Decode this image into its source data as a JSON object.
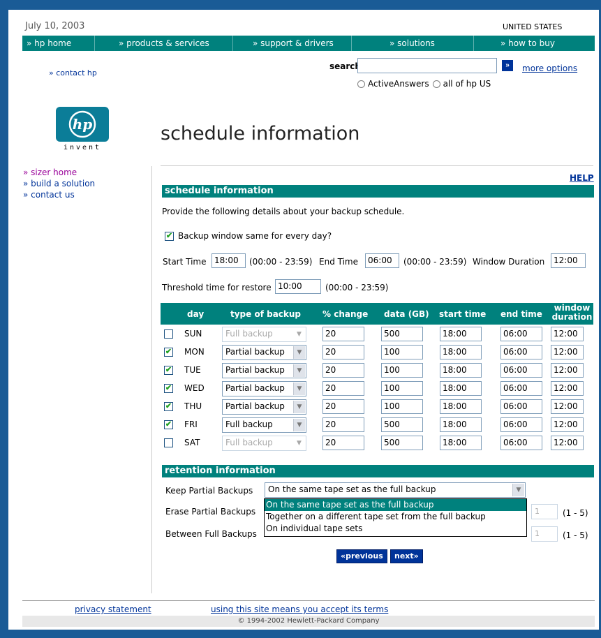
{
  "header": {
    "date": "July 10, 2003",
    "country": "UNITED STATES"
  },
  "topnav": [
    {
      "label": "» hp home"
    },
    {
      "label": "» products & services"
    },
    {
      "label": "» support & drivers"
    },
    {
      "label": "» solutions"
    },
    {
      "label": "» how to buy"
    }
  ],
  "contact_hp": "» contact hp",
  "search": {
    "label": "search:",
    "value": "",
    "go": "»",
    "more_options": "more options",
    "radio_1": "ActiveAnswers",
    "radio_2": "all of hp US"
  },
  "logo": {
    "mark": "hp",
    "tagline": "invent"
  },
  "page_title": "schedule information",
  "leftnav": [
    {
      "label": "» sizer home"
    },
    {
      "label": "» build a solution"
    },
    {
      "label": "» contact us"
    }
  ],
  "help": "HELP",
  "schedule": {
    "section_title": "schedule information",
    "intro": "Provide the following details about your backup schedule.",
    "same_window_label": "Backup window same for every day?",
    "same_window_checked": true,
    "start_time_label": "Start Time",
    "start_time": "18:00",
    "range_hint": "(00:00 - 23:59)",
    "end_time_label": "End Time",
    "end_time": "06:00",
    "window_duration_label": "Window Duration",
    "window_duration": "12:00",
    "threshold_label": "Threshold time for restore",
    "threshold": "10:00"
  },
  "table": {
    "headers": {
      "day": "day",
      "type": "type of backup",
      "change": "% change",
      "data": "data (GB)",
      "start": "start time",
      "end": "end time",
      "window_1": "window",
      "window_2": "duration"
    },
    "rows": [
      {
        "checked": false,
        "day": "SUN",
        "type": "Full backup",
        "enabled": false,
        "change": "20",
        "data": "500",
        "start": "18:00",
        "end": "06:00",
        "window": "12:00"
      },
      {
        "checked": true,
        "day": "MON",
        "type": "Partial backup",
        "enabled": true,
        "change": "20",
        "data": "100",
        "start": "18:00",
        "end": "06:00",
        "window": "12:00"
      },
      {
        "checked": true,
        "day": "TUE",
        "type": "Partial backup",
        "enabled": true,
        "change": "20",
        "data": "100",
        "start": "18:00",
        "end": "06:00",
        "window": "12:00"
      },
      {
        "checked": true,
        "day": "WED",
        "type": "Partial backup",
        "enabled": true,
        "change": "20",
        "data": "100",
        "start": "18:00",
        "end": "06:00",
        "window": "12:00"
      },
      {
        "checked": true,
        "day": "THU",
        "type": "Partial backup",
        "enabled": true,
        "change": "20",
        "data": "100",
        "start": "18:00",
        "end": "06:00",
        "window": "12:00"
      },
      {
        "checked": true,
        "day": "FRI",
        "type": "Full backup",
        "enabled": true,
        "change": "20",
        "data": "500",
        "start": "18:00",
        "end": "06:00",
        "window": "12:00"
      },
      {
        "checked": false,
        "day": "SAT",
        "type": "Full backup",
        "enabled": false,
        "change": "20",
        "data": "500",
        "start": "18:00",
        "end": "06:00",
        "window": "12:00"
      }
    ]
  },
  "retention": {
    "section_title": "retention information",
    "keep_label": "Keep Partial Backups",
    "keep_value": "On the same tape set as the full backup",
    "erase_label": "Erase Partial Backups",
    "between_label": "Between Full Backups",
    "options": [
      "On the same tape set as the full backup",
      "Together on a different tape set from the full backup",
      "On individual tape sets"
    ],
    "erase_value": "1",
    "between_value": "1",
    "range_hint": "(1 - 5)"
  },
  "buttons": {
    "previous": "«previous",
    "next": "next»"
  },
  "footer": {
    "privacy": "privacy statement",
    "terms": "using this site means you accept its terms",
    "copyright": "© 1994-2002 Hewlett-Packard Company"
  },
  "colors": {
    "teal": "#00817d",
    "frame_blue": "#1a5b96",
    "link_blue": "#003399"
  }
}
